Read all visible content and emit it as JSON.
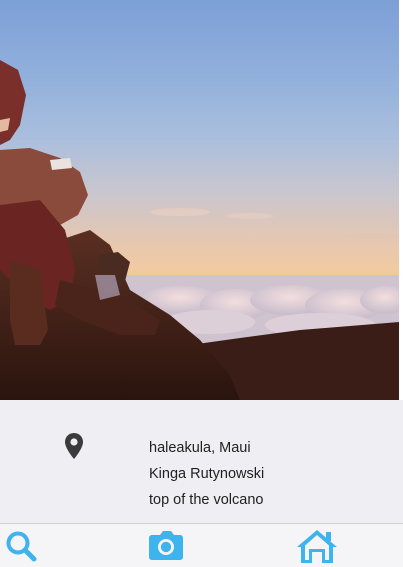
{
  "photo": {
    "icon": "sunset-clouds-photo"
  },
  "details": {
    "location_icon": "map-pin-icon",
    "location": "haleakula, Maui",
    "author": "Kinga Rutynowski",
    "caption": "top of the volcano"
  },
  "tabbar": {
    "accent": "#3fb3ee",
    "items": [
      {
        "icon": "search-icon"
      },
      {
        "icon": "camera-icon"
      },
      {
        "icon": "home-icon"
      }
    ]
  }
}
